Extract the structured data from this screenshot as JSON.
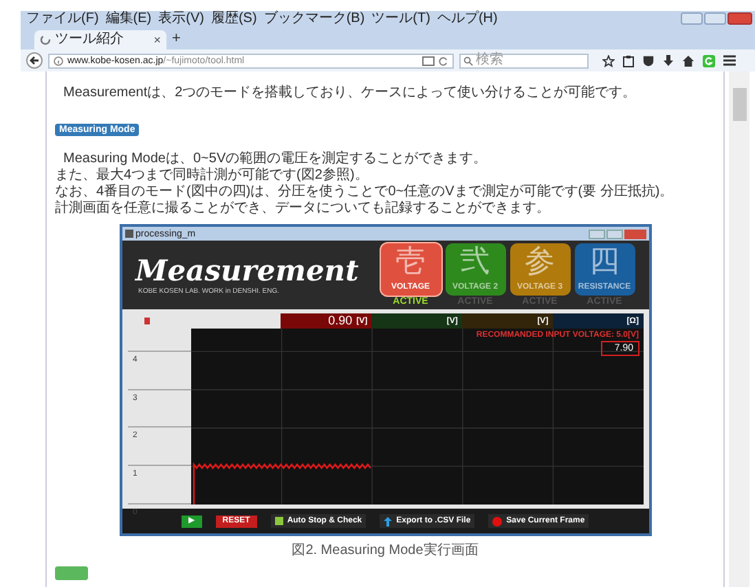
{
  "browser": {
    "menu": [
      "ファイル(F)",
      "編集(E)",
      "表示(V)",
      "履歴(S)",
      "ブックマーク(B)",
      "ツール(T)",
      "ヘルプ(H)"
    ],
    "tab": {
      "title": "ツール紹介",
      "close": "×"
    },
    "new_tab": "+",
    "url": {
      "host": "www.kobe-kosen.ac.jp",
      "path": "/~fujimoto/tool.html"
    },
    "search": {
      "placeholder": "検索"
    }
  },
  "page": {
    "intro": "Measurementは、2つのモードを搭載しており、ケースによって使い分けることが可能です。",
    "badge": "Measuring Mode",
    "paragraph": [
      "Measuring Modeは、0~5Vの範囲の電圧を測定することができます。",
      "また、最大4つまで同時計測が可能です(図2参照)。",
      "なお、4番目のモード(図中の四)は、分圧を使うことで0~任意のVまで測定が可能です(要 分圧抵抗)。",
      "計測画面を任意に撮ることができ、データについても記録することができます。"
    ],
    "app": {
      "window_title": "processing_m",
      "logo": "Measurement",
      "subtitle": "KOBE KOSEN LAB. WORK in DENSHI. ENG.",
      "modes": [
        {
          "glyph": "壱",
          "label": "VOLTAGE",
          "status": "ACTIVE",
          "selected": true,
          "color": "#e0503e"
        },
        {
          "glyph": "弐",
          "label": "VOLTAGE 2",
          "status": "ACTIVE",
          "selected": false,
          "color": "#2f8a1e"
        },
        {
          "glyph": "参",
          "label": "VOLTAGE 3",
          "status": "ACTIVE",
          "selected": false,
          "color": "#b07a0c"
        },
        {
          "glyph": "四",
          "label": "RESISTANCE",
          "status": "ACTIVE",
          "selected": false,
          "color": "#1a5f9e"
        }
      ],
      "readouts": [
        {
          "value": "0.90",
          "unit": "[V]",
          "color": "#7a0808"
        },
        {
          "unit": "[V]",
          "color": "#163416"
        },
        {
          "unit": "[V]",
          "color": "#33250a"
        },
        {
          "unit": "[Ω]",
          "color": "#0c2238"
        }
      ],
      "notice": "RECOMMANDED INPUT VOLTAGE: 5.0[V]",
      "input_value": "7.90",
      "y_ticks": [
        "4",
        "3",
        "2",
        "1",
        "0"
      ],
      "toolbar": [
        {
          "kind": "play",
          "label": "▶"
        },
        {
          "kind": "reset",
          "label": "RESET"
        },
        {
          "kind": "check",
          "label": "Auto Stop & Check"
        },
        {
          "kind": "export",
          "label": "Export to .CSV File"
        },
        {
          "kind": "save",
          "label": "Save Current Frame"
        }
      ]
    },
    "caption": "図2. Measuring Mode実行画面"
  }
}
